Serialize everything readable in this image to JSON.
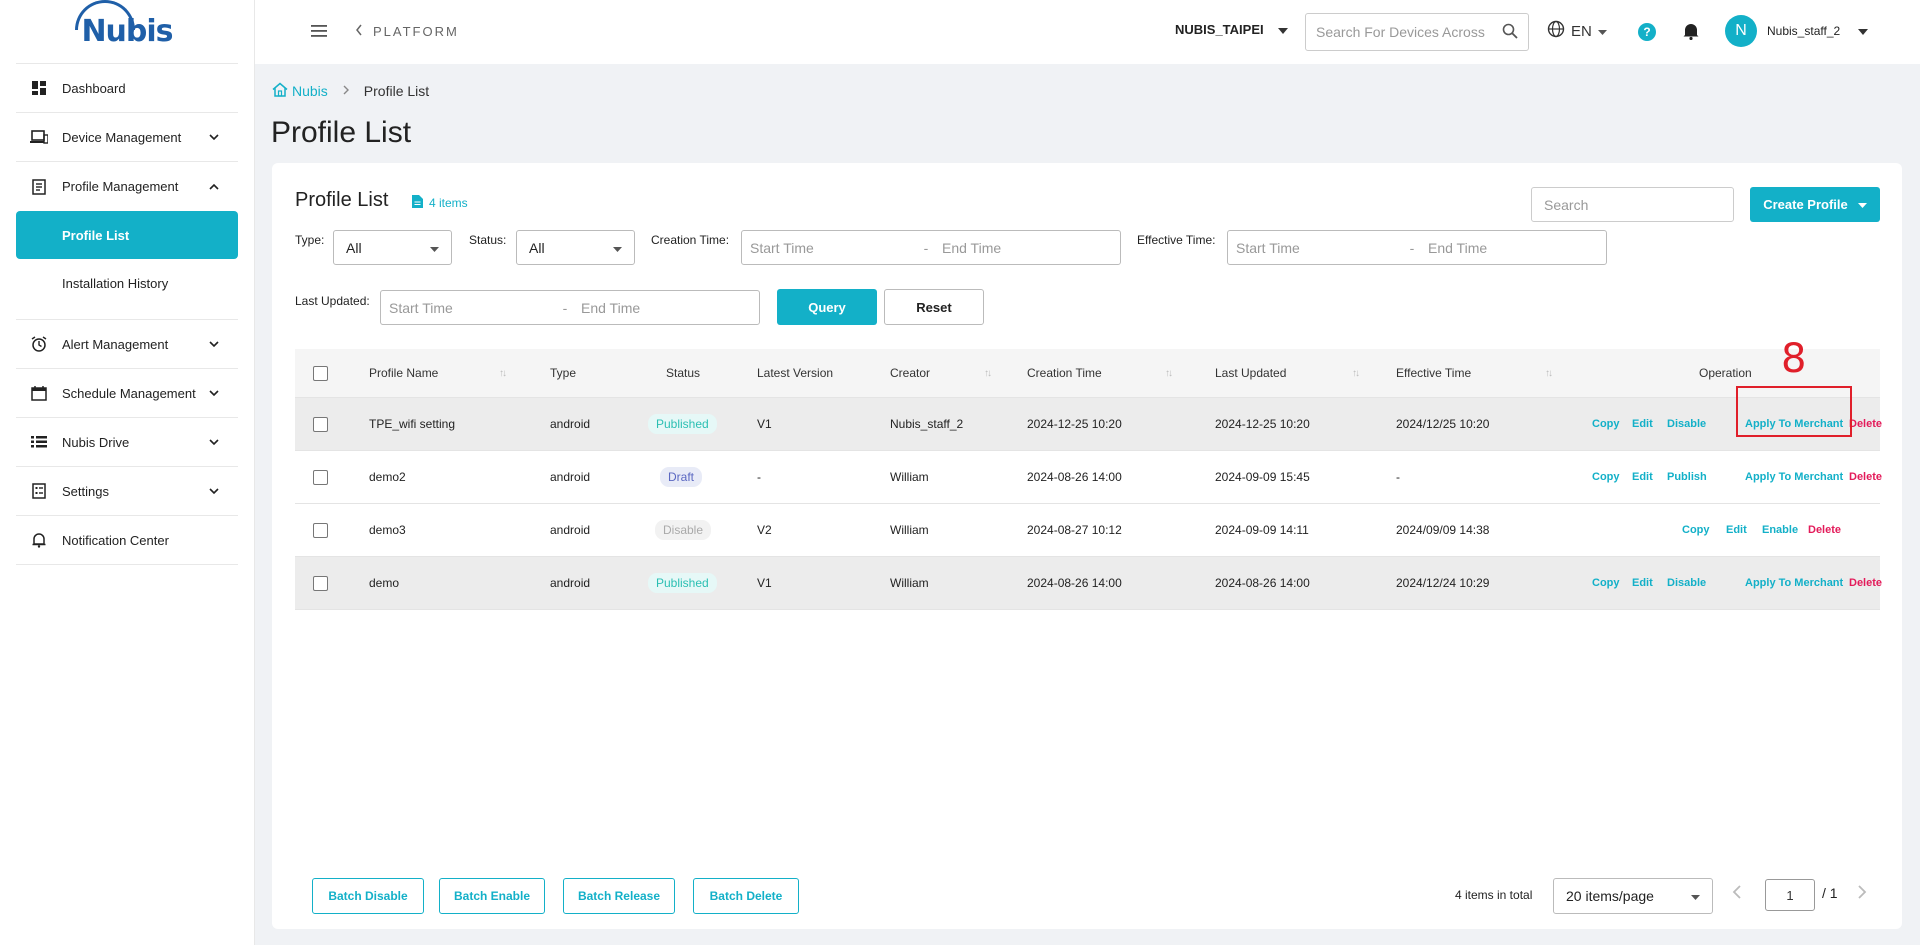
{
  "brand": {
    "name": "Nubis"
  },
  "sidebar": {
    "items": [
      {
        "label": "Dashboard"
      },
      {
        "label": "Device Management"
      },
      {
        "label": "Profile Management"
      },
      {
        "label": "Alert Management"
      },
      {
        "label": "Schedule Management"
      },
      {
        "label": "Nubis Drive"
      },
      {
        "label": "Settings"
      },
      {
        "label": "Notification Center"
      }
    ],
    "sub_items": [
      {
        "label": "Profile List",
        "active": true
      },
      {
        "label": "Installation History",
        "active": false
      }
    ]
  },
  "header": {
    "platform": "PLATFORM",
    "tenant": "NUBIS_TAIPEI",
    "search_placeholder": "Search For Devices Across",
    "language": "EN",
    "help": "?",
    "avatar_initial": "N",
    "username": "Nubis_staff_2"
  },
  "breadcrumb": {
    "home": "Nubis",
    "current": "Profile List"
  },
  "page_title": "Profile List",
  "card": {
    "title": "Profile List",
    "items_count": "4 items",
    "search_placeholder": "Search",
    "create_label": "Create Profile"
  },
  "filters": {
    "type_label": "Type:",
    "type_value": "All",
    "status_label": "Status:",
    "status_value": "All",
    "creation_label": "Creation Time:",
    "effective_label": "Effective Time:",
    "updated_label": "Last Updated:",
    "start_placeholder": "Start Time",
    "end_placeholder": "End Time",
    "range_sep": "-",
    "query_label": "Query",
    "reset_label": "Reset"
  },
  "table": {
    "headers": {
      "name": "Profile Name",
      "type": "Type",
      "status": "Status",
      "version": "Latest Version",
      "creator": "Creator",
      "created": "Creation Time",
      "updated": "Last Updated",
      "effective": "Effective Time",
      "operation": "Operation"
    },
    "rows": [
      {
        "name": "TPE_wifi setting",
        "type": "android",
        "status": "Published",
        "version": "V1",
        "creator": "Nubis_staff_2",
        "created": "2024-12-25 10:20",
        "updated": "2024-12-25 10:20",
        "effective": "2024/12/25 10:20",
        "ops": [
          "Copy",
          "Edit",
          "Disable",
          "Apply To Merchant",
          "Delete"
        ]
      },
      {
        "name": "demo2",
        "type": "android",
        "status": "Draft",
        "version": "-",
        "creator": "William",
        "created": "2024-08-26 14:00",
        "updated": "2024-09-09 15:45",
        "effective": "-",
        "ops": [
          "Copy",
          "Edit",
          "Publish",
          "Apply To Merchant",
          "Delete"
        ]
      },
      {
        "name": "demo3",
        "type": "android",
        "status": "Disable",
        "version": "V2",
        "creator": "William",
        "created": "2024-08-27 10:12",
        "updated": "2024-09-09 14:11",
        "effective": "2024/09/09 14:38",
        "ops": [
          "Copy",
          "Edit",
          "Enable",
          "Delete"
        ]
      },
      {
        "name": "demo",
        "type": "android",
        "status": "Published",
        "version": "V1",
        "creator": "William",
        "created": "2024-08-26 14:00",
        "updated": "2024-08-26 14:00",
        "effective": "2024/12/24 10:29",
        "ops": [
          "Copy",
          "Edit",
          "Disable",
          "Apply To Merchant",
          "Delete"
        ]
      }
    ]
  },
  "annotation": {
    "step": "8"
  },
  "footer": {
    "batch_disable": "Batch Disable",
    "batch_enable": "Batch Enable",
    "batch_release": "Batch Release",
    "batch_delete": "Batch Delete",
    "total": "4 items in total",
    "page_size": "20 items/page",
    "page": "1",
    "of_pages": "/ 1"
  },
  "colors": {
    "accent": "#13b0c8",
    "danger": "#e31b5a",
    "annotation": "#e01f2a"
  }
}
